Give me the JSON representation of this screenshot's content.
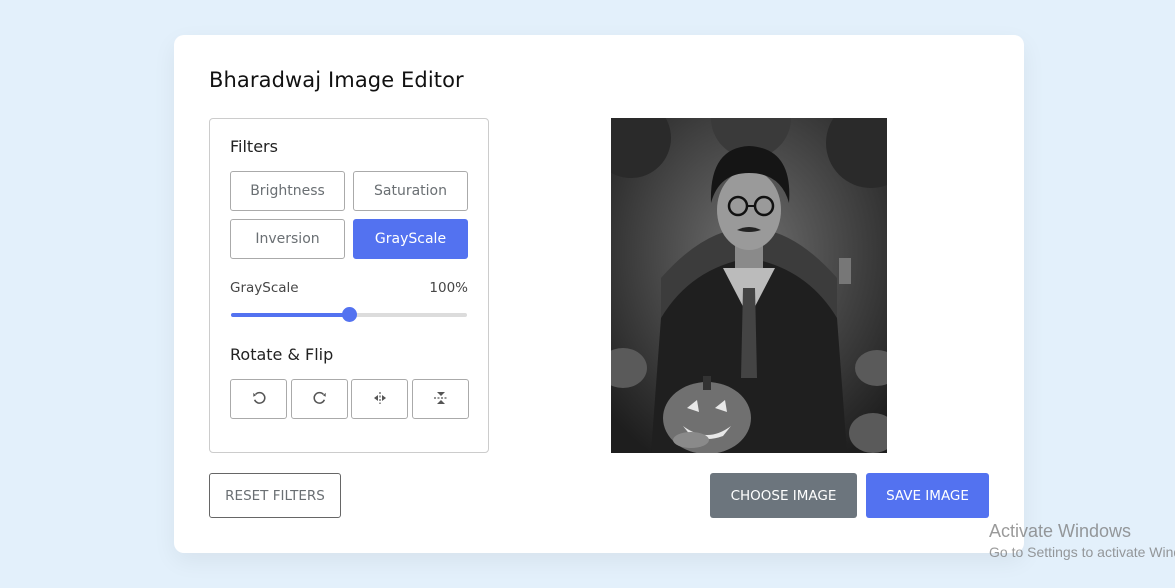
{
  "app": {
    "title": "Bharadwaj Image Editor"
  },
  "filters": {
    "heading": "Filters",
    "options": [
      {
        "label": "Brightness",
        "active": false
      },
      {
        "label": "Saturation",
        "active": false
      },
      {
        "label": "Inversion",
        "active": false
      },
      {
        "label": "GrayScale",
        "active": true
      }
    ],
    "slider": {
      "name": "GrayScale",
      "value_text": "100%",
      "value": 100,
      "max": 200
    }
  },
  "rotate": {
    "heading": "Rotate & Flip",
    "buttons": [
      "rotate-left-icon",
      "rotate-right-icon",
      "flip-horizontal-icon",
      "flip-vertical-icon"
    ]
  },
  "actions": {
    "reset": "RESET FILTERS",
    "choose": "CHOOSE IMAGE",
    "save": "SAVE IMAGE"
  },
  "watermark": {
    "title": "Activate Windows",
    "subtitle": "Go to Settings to activate Windows."
  },
  "colors": {
    "accent": "#5372f0",
    "secondary": "#6c757d",
    "background": "#e3f0fb"
  }
}
